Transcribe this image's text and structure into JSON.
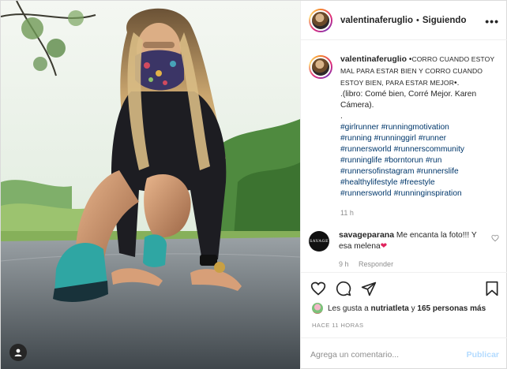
{
  "post": {
    "username": "valentinaferuglio",
    "follow_separator": "•",
    "follow_status": "Siguiendo",
    "more_icon": "more-options-icon"
  },
  "caption": {
    "username": "valentinaferuglio",
    "text_lead": "•",
    "text_smallcaps": "Corro cuando estoy mal para estar bien y corro cuando estoy bien, para estar mejor",
    "text_tail": "•.",
    "book_line": ".(libro: Comé bien, Corré Mejor. Karen Cámera).",
    "dot_line": ".",
    "hashtags": [
      "#girlrunner",
      "#runningmotivation",
      "#running",
      "#runninggirl",
      "#runner",
      "#runnersworld",
      "#runnerscommunity",
      "#runninglife",
      "#borntorun",
      "#run",
      "#runnersofinstagram",
      "#runnerslife",
      "#healthylifestyle",
      "#freestyle",
      "#runnersworld",
      "#runninginspiration"
    ],
    "time": "11 h"
  },
  "comment": {
    "avatar_text": "SAVAGE",
    "username": "savageparana",
    "text": "Me encanta la foto!!! Y esa melena",
    "emoji": "❤",
    "meta_time": "9 h",
    "meta_reply": "Responder"
  },
  "actions": {
    "likes_prefix": "Les gusta a",
    "likes_user": "nutriatleta",
    "likes_conj": "y",
    "likes_count": "165 personas más",
    "ago": "HACE 11 HORAS",
    "comment_placeholder": "Agrega un comentario...",
    "publish_label": "Publicar"
  },
  "colors": {
    "link": "#00376b",
    "muted": "#8e8e8e",
    "publish_disabled": "#b3dbff",
    "heart": "#e0245e"
  }
}
